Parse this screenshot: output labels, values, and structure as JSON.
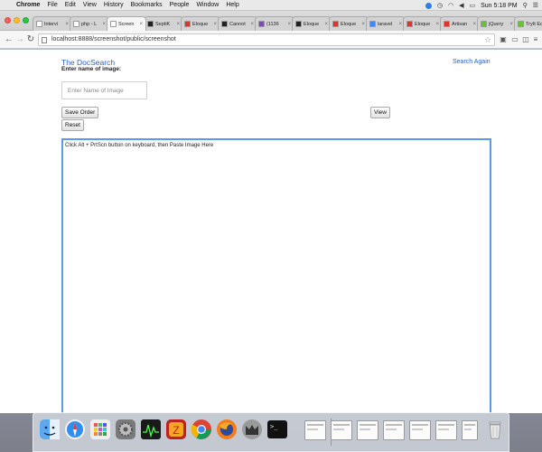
{
  "menubar": {
    "app_name": "Chrome",
    "items": [
      "File",
      "Edit",
      "View",
      "History",
      "Bookmarks",
      "People",
      "Window",
      "Help"
    ],
    "clock": "Sun 5:18 PM"
  },
  "tabs": [
    {
      "label": "Intervi",
      "color": "#ffffff"
    },
    {
      "label": "php - L",
      "color": "#ffffff"
    },
    {
      "label": "Screen",
      "color": "#ffffff",
      "active": true
    },
    {
      "label": "SeptiK",
      "color": "#222222"
    },
    {
      "label": "Eloque",
      "color": "#e0342a"
    },
    {
      "label": "Cannot",
      "color": "#222222"
    },
    {
      "label": "(1136",
      "color": "#7b4bb8"
    },
    {
      "label": "Eloque",
      "color": "#222222"
    },
    {
      "label": "Eloque",
      "color": "#e0342a"
    },
    {
      "label": "laravel",
      "color": "#4285f4"
    },
    {
      "label": "Eloque",
      "color": "#e0342a"
    },
    {
      "label": "Artisan",
      "color": "#e0342a"
    },
    {
      "label": "jQuery",
      "color": "#6bbf3a"
    },
    {
      "label": "TryIt Ec",
      "color": "#6bbf3a"
    }
  ],
  "address_bar": {
    "url": "localhost:8888/screenshot/public/screenshot"
  },
  "page": {
    "brand": "The DocSearch",
    "search_again": "Search Again",
    "field_label": "Enter name of image:",
    "name_placeholder": "Enter Name of Image",
    "save_order": "Save Order",
    "reset": "Reset",
    "view": "View",
    "paste_hint": "Click Alt + PrtScn button on keyboard, then Paste Image Here"
  },
  "dock": {
    "apps": [
      "finder-icon",
      "safari-icon",
      "launchpad-icon",
      "system-preferences-icon",
      "activity-monitor-icon",
      "filezilla-icon",
      "chrome-icon",
      "firefox-icon",
      "mamp-icon",
      "terminal-icon"
    ],
    "documents": [
      "document-thumbnail",
      "document-thumbnail",
      "document-thumbnail",
      "document-thumbnail",
      "document-thumbnail",
      "document-thumbnail",
      "document-thumbnail",
      "document-thumbnail"
    ],
    "trash": "trash-icon"
  }
}
